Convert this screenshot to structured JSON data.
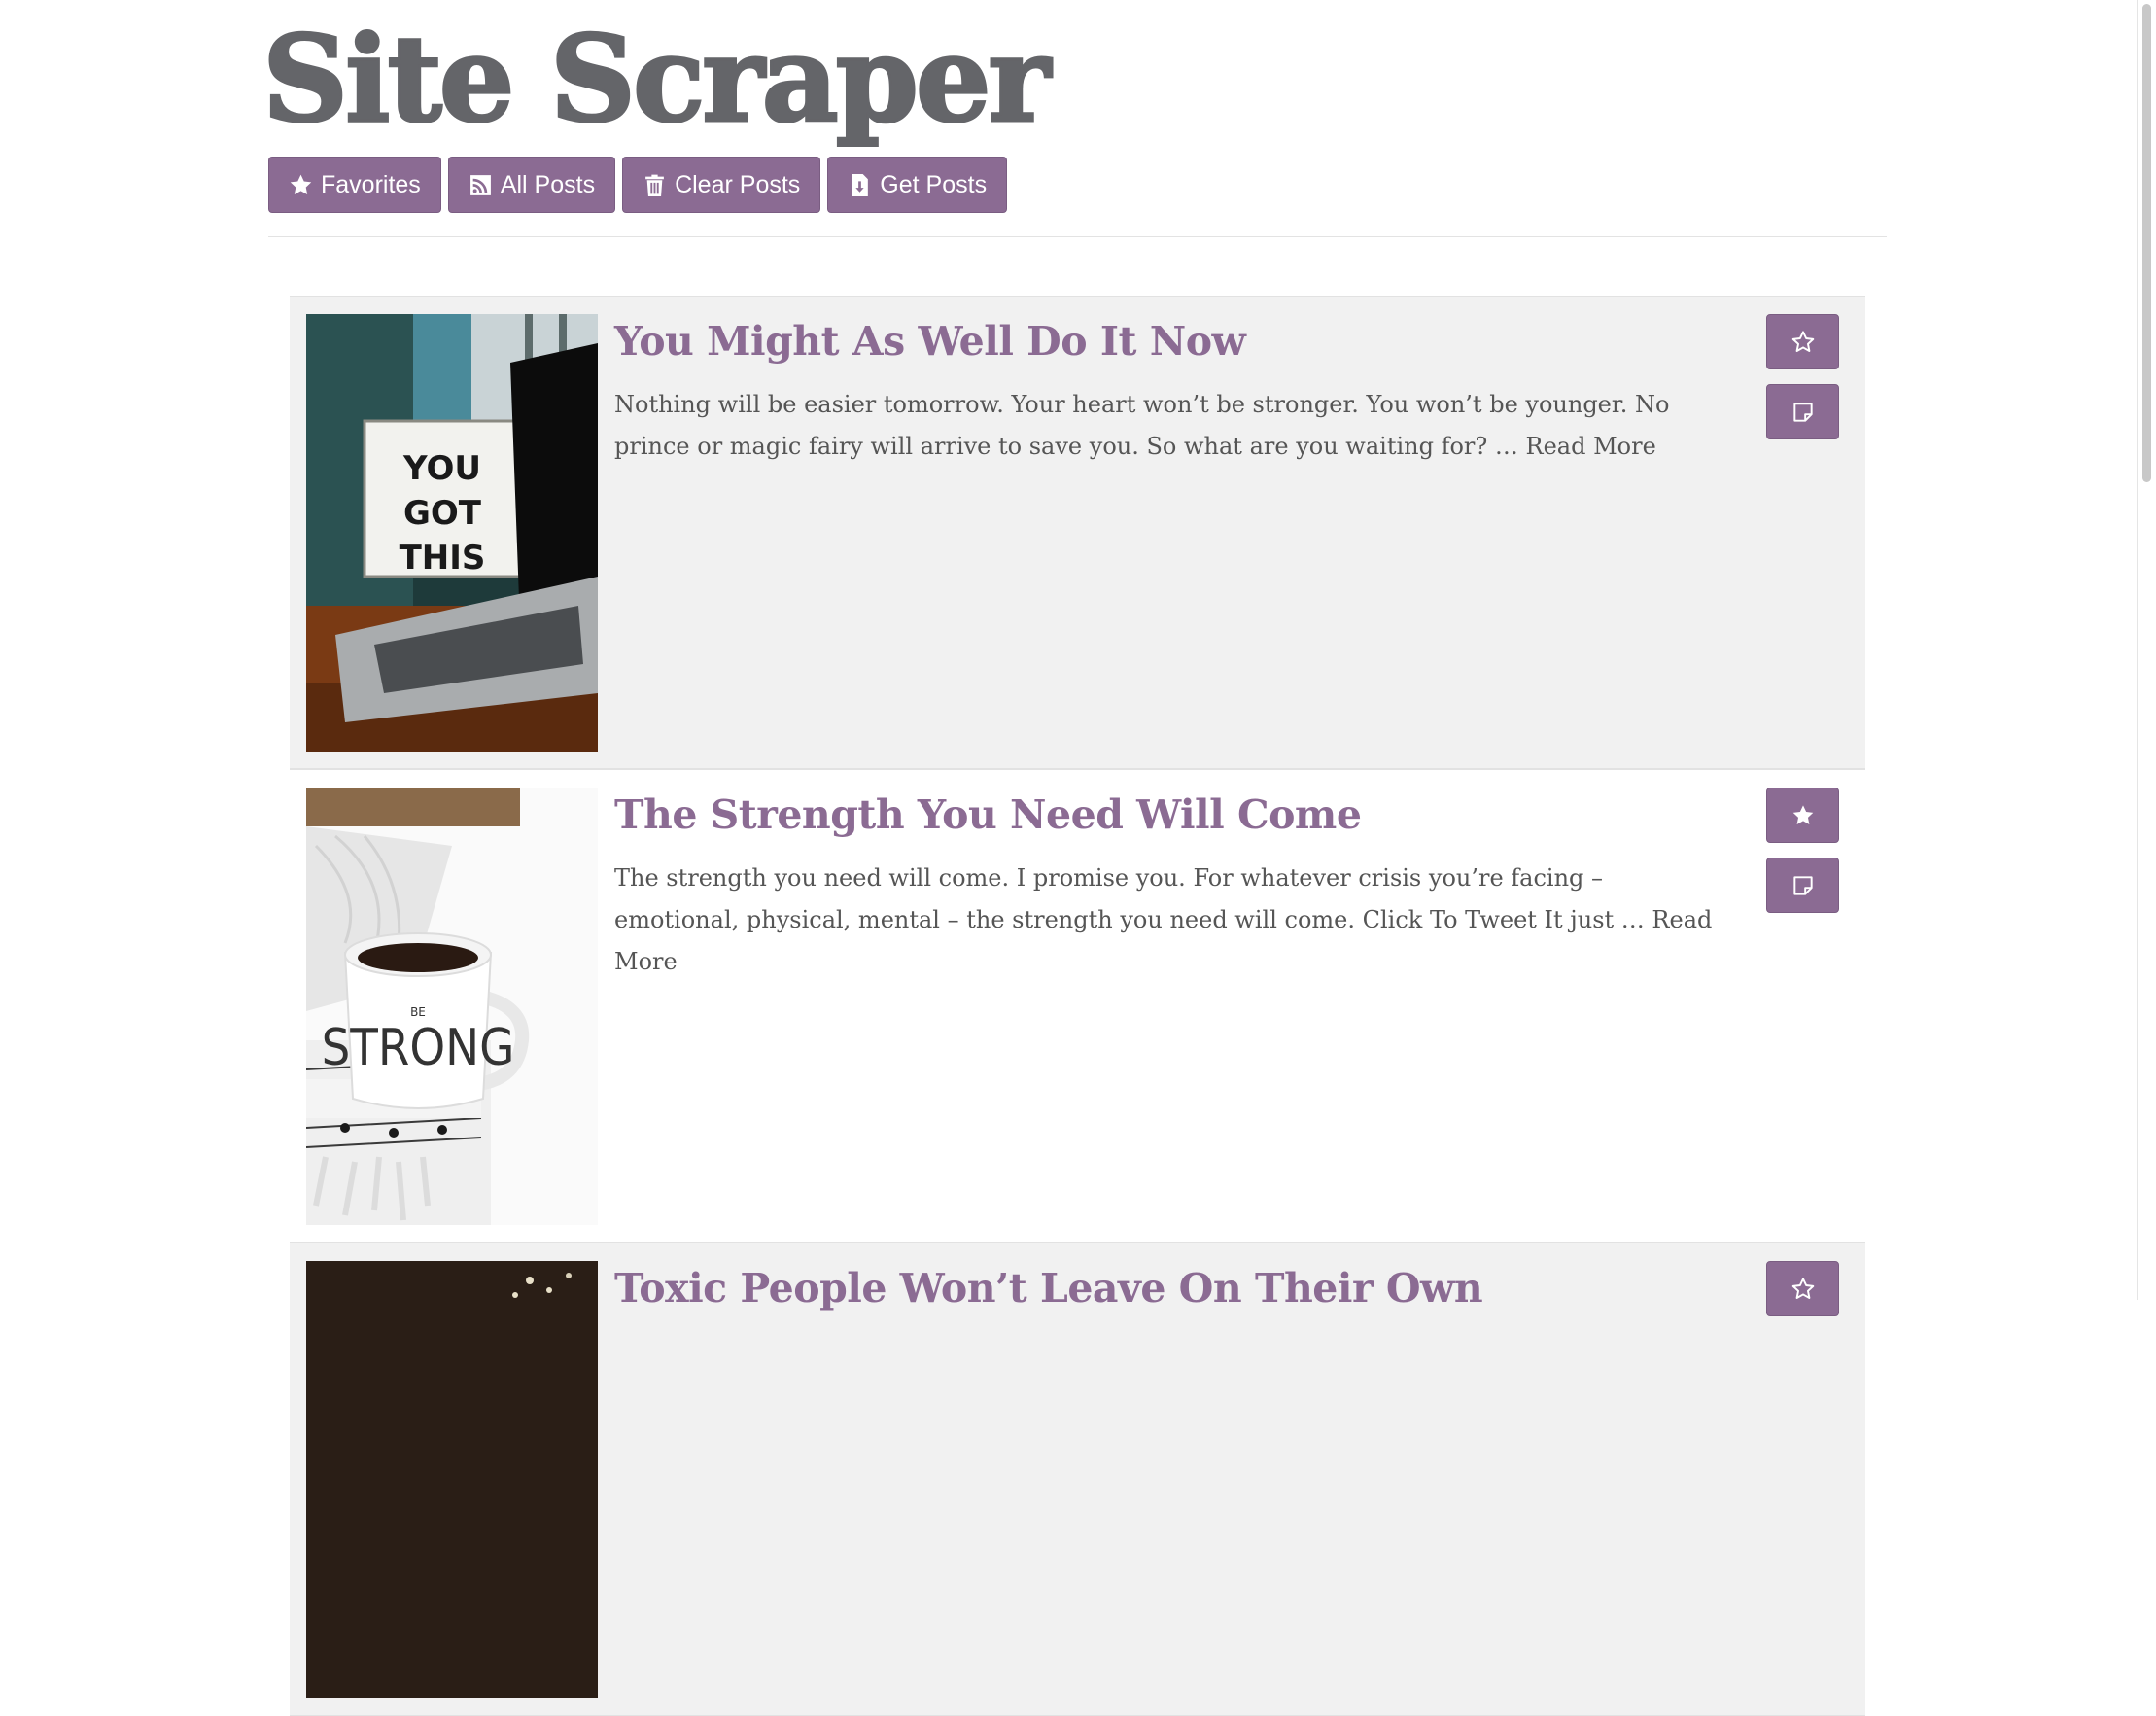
{
  "site": {
    "title": "Site Scraper"
  },
  "nav": {
    "favorites_label": "Favorites",
    "all_posts_label": "All Posts",
    "clear_posts_label": "Clear Posts",
    "get_posts_label": "Get Posts",
    "icons": [
      "star-icon",
      "rss-icon",
      "trash-icon",
      "download-file-icon"
    ]
  },
  "posts": [
    {
      "title": "You Might As Well Do It Now",
      "excerpt": "Nothing will be easier tomorrow. Your heart won’t be stronger. You won’t be younger. No prince or magic fairy will arrive to save you. So what are you waiting for? … ",
      "read_more": "Read More",
      "favorited": false,
      "image_text": [
        "YOU",
        "GOT",
        "THIS"
      ]
    },
    {
      "title": "The Strength You Need Will Come",
      "excerpt": "The strength you need will come. I promise you. For whatever crisis you’re facing – emotional, physical, mental – the strength you need will come. Click To Tweet It just … ",
      "read_more": "Read More",
      "favorited": true,
      "image_text": [
        "BE",
        "STRONG"
      ]
    },
    {
      "title": "Toxic People Won’t Leave On Their Own",
      "excerpt": "",
      "read_more": "",
      "favorited": false
    }
  ],
  "colors": {
    "accent": "#8b6b93",
    "title_gray": "#646569",
    "text": "#555555",
    "row_shade": "#f1f1f1"
  }
}
